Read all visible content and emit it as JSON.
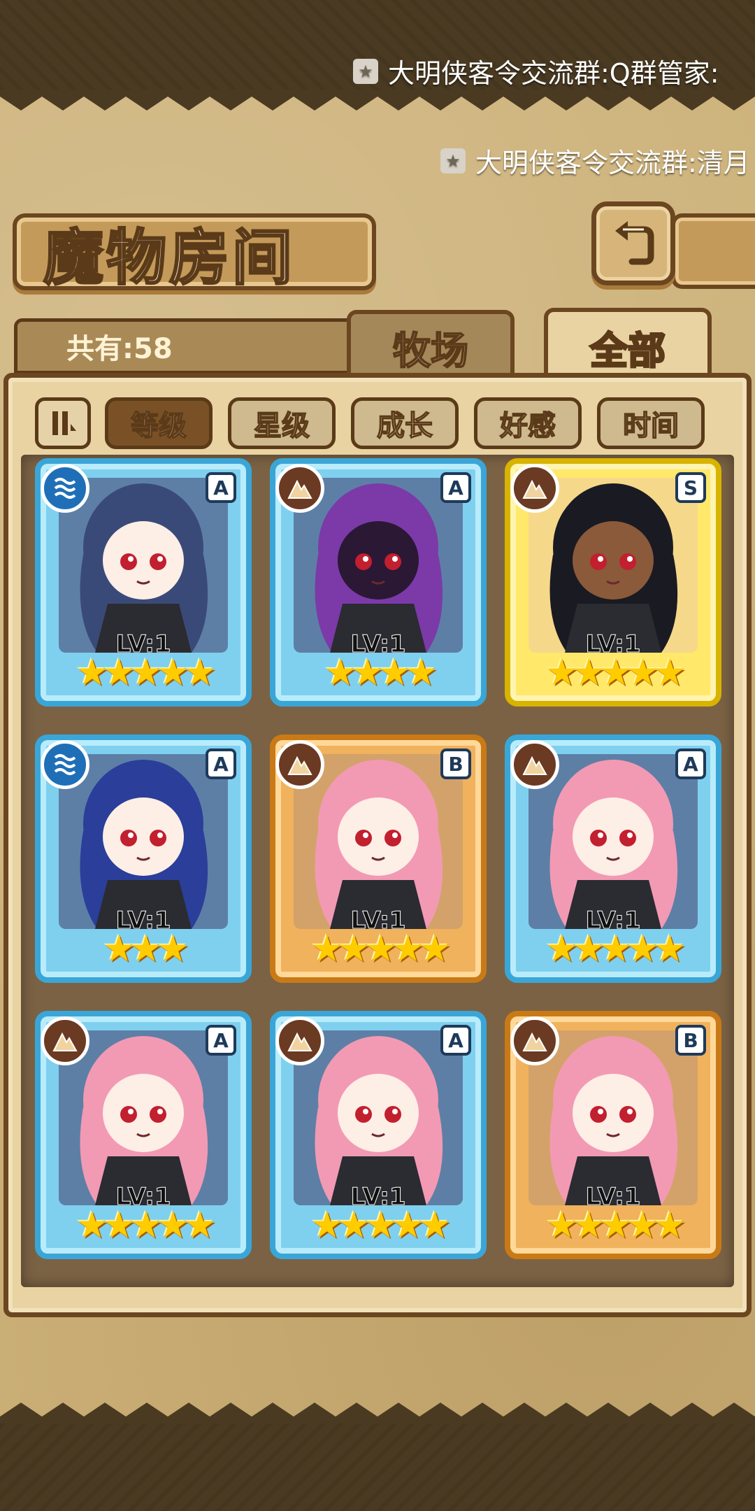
{
  "marquee": {
    "line1": "大明侠客令交流群:Q群管家:",
    "line2": "大明侠客令交流群:清月"
  },
  "header": {
    "title": "魔物房间",
    "count_label": "共有:58",
    "tabs": [
      {
        "label": "牧场",
        "active": false
      },
      {
        "label": "全部",
        "active": true
      }
    ]
  },
  "sort": {
    "buttons": [
      {
        "label": "等级",
        "active": true
      },
      {
        "label": "星级",
        "active": false
      },
      {
        "label": "成长",
        "active": false
      },
      {
        "label": "好感",
        "active": false
      },
      {
        "label": "时间",
        "active": false
      }
    ]
  },
  "cards": [
    {
      "rank": "A",
      "level": "LV:1",
      "stars": "★★★★★",
      "frame": "blue",
      "element": "water",
      "hair": "#3a4a78",
      "skin": "#fdeee6"
    },
    {
      "rank": "A",
      "level": "LV:1",
      "stars": "★★★★",
      "frame": "blue",
      "element": "earth",
      "hair": "#7b3aa8",
      "skin": "#2a1835"
    },
    {
      "rank": "S",
      "level": "LV:1",
      "stars": "★★★★★",
      "frame": "gold",
      "element": "earth",
      "hair": "#1a1a22",
      "skin": "#8a5a3a"
    },
    {
      "rank": "A",
      "level": "LV:1",
      "stars": "★★★",
      "frame": "blue",
      "element": "water",
      "hair": "#2a3e9a",
      "skin": "#fdeee6"
    },
    {
      "rank": "B",
      "level": "LV:1",
      "stars": "★★★★★",
      "frame": "orange",
      "element": "earth",
      "hair": "#f29ab3",
      "skin": "#fdeee6"
    },
    {
      "rank": "A",
      "level": "LV:1",
      "stars": "★★★★★",
      "frame": "blue",
      "element": "earth",
      "hair": "#f29ab3",
      "skin": "#fdeee6"
    },
    {
      "rank": "A",
      "level": "LV:1",
      "stars": "★★★★★",
      "frame": "blue",
      "element": "earth",
      "hair": "#f29ab3",
      "skin": "#fdeee6"
    },
    {
      "rank": "A",
      "level": "LV:1",
      "stars": "★★★★★",
      "frame": "blue",
      "element": "earth",
      "hair": "#f29ab3",
      "skin": "#fdeee6"
    },
    {
      "rank": "B",
      "level": "LV:1",
      "stars": "★★★★★",
      "frame": "orange",
      "element": "earth",
      "hair": "#f29ab3",
      "skin": "#fdeee6"
    }
  ]
}
